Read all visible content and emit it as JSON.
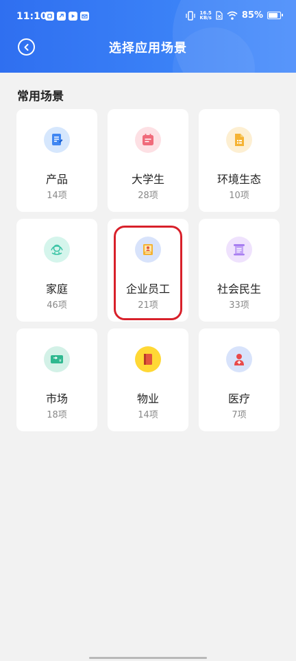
{
  "status_bar": {
    "time": "11:10",
    "net_speed_value": "16.5",
    "net_speed_unit": "KB/s",
    "battery_percent": "85%",
    "battery_level": 0.85
  },
  "header": {
    "title": "选择应用场景"
  },
  "section": {
    "title": "常用场景"
  },
  "scenes": [
    {
      "name": "产品",
      "count": "14项",
      "icon": "document-icon",
      "icon_color": "#3f86f2",
      "icon_bg": "#d6e7fd"
    },
    {
      "name": "大学生",
      "count": "28项",
      "icon": "calendar-icon",
      "icon_color": "#f06a7a",
      "icon_bg": "#fde0e4"
    },
    {
      "name": "环境生态",
      "count": "10项",
      "icon": "file-icon",
      "icon_color": "#f5b333",
      "icon_bg": "#fdefd2"
    },
    {
      "name": "家庭",
      "count": "46项",
      "icon": "home-icon",
      "icon_color": "#3cc4a6",
      "icon_bg": "#d5f5ec"
    },
    {
      "name": "企业员工",
      "count": "21项",
      "icon": "employee-icon",
      "icon_color": "#f5b333",
      "icon_bg": "#d8e3fb"
    },
    {
      "name": "社会民生",
      "count": "33项",
      "icon": "scroll-icon",
      "icon_color": "#a87ef0",
      "icon_bg": "#efe2fd"
    },
    {
      "name": "市场",
      "count": "18项",
      "icon": "wallet-icon",
      "icon_color": "#2fb88f",
      "icon_bg": "#d3f1e7"
    },
    {
      "name": "物业",
      "count": "14项",
      "icon": "book-icon",
      "icon_color": "#e2553d",
      "icon_bg": "#ffd835"
    },
    {
      "name": "医疗",
      "count": "7项",
      "icon": "doctor-icon",
      "icon_color": "#e84a4a",
      "icon_bg": "#d8e3fb"
    }
  ]
}
